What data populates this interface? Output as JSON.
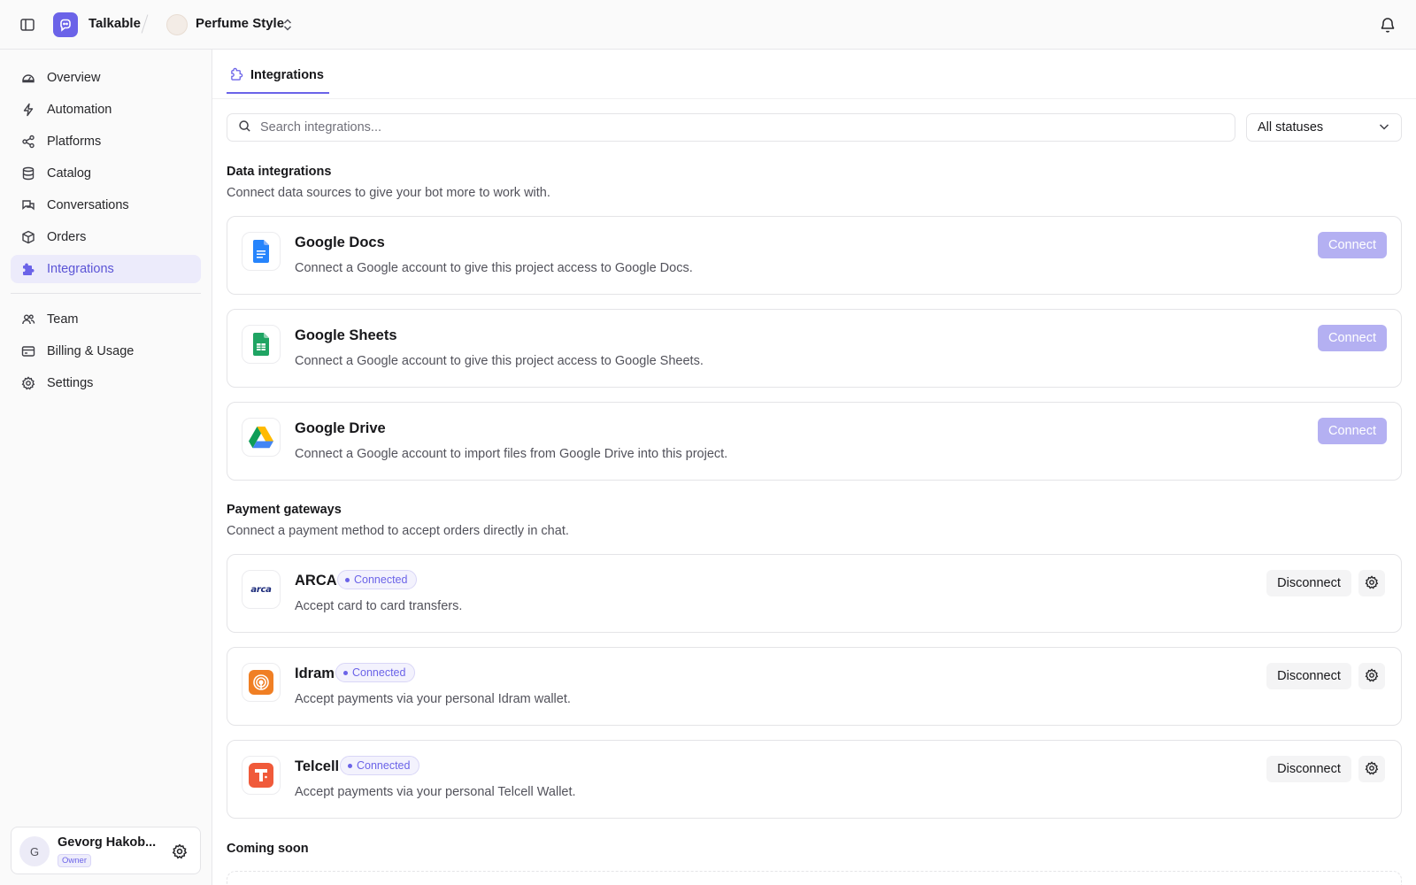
{
  "header": {
    "sidebar_toggle_icon": "sidebar-panel-icon",
    "app_name": "Talkable",
    "project_name": "Perfume Style",
    "notifications_icon": "bell-icon"
  },
  "sidebar": {
    "items": [
      {
        "label": "Overview",
        "icon": "dashboard-gauge-icon"
      },
      {
        "label": "Automation",
        "icon": "bolt-icon"
      },
      {
        "label": "Platforms",
        "icon": "share-nodes-icon"
      },
      {
        "label": "Catalog",
        "icon": "database-icon"
      },
      {
        "label": "Conversations",
        "icon": "chat-bubbles-icon"
      },
      {
        "label": "Orders",
        "icon": "box-icon"
      },
      {
        "label": "Integrations",
        "icon": "puzzle-icon",
        "active": true
      },
      {
        "label": "Team",
        "icon": "users-icon"
      },
      {
        "label": "Billing & Usage",
        "icon": "credit-card-icon"
      },
      {
        "label": "Settings",
        "icon": "gear-icon"
      }
    ],
    "user": {
      "initial": "G",
      "name": "Gevorg Hakob...",
      "role": "Owner"
    }
  },
  "tabs": [
    {
      "label": "Integrations",
      "icon": "puzzle-icon",
      "active": true
    }
  ],
  "search": {
    "placeholder": "Search integrations..."
  },
  "status_filter": {
    "selected": "All statuses"
  },
  "data_integrations": {
    "title": "Data integrations",
    "description": "Connect data sources to give your bot more to work with.",
    "items": [
      {
        "name": "Google Docs",
        "description": "Connect a Google account to give this project access to Google Docs.",
        "action": "Connect"
      },
      {
        "name": "Google Sheets",
        "description": "Connect a Google account to give this project access to Google Sheets.",
        "action": "Connect"
      },
      {
        "name": "Google Drive",
        "description": "Connect a Google account to import files from Google Drive into this project.",
        "action": "Connect"
      }
    ]
  },
  "payment_gateways": {
    "title": "Payment gateways",
    "description": "Connect a payment method to accept orders directly in chat.",
    "items": [
      {
        "name": "ARCA",
        "logo_text": "arca",
        "status": "Connected",
        "description": "Accept card to card transfers.",
        "action": "Disconnect"
      },
      {
        "name": "Idram",
        "status": "Connected",
        "description": "Accept payments via your personal Idram wallet.",
        "action": "Disconnect"
      },
      {
        "name": "Telcell",
        "status": "Connected",
        "description": "Accept payments via your personal Telcell Wallet.",
        "action": "Disconnect"
      }
    ]
  },
  "coming_soon": {
    "title": "Coming soon"
  },
  "colors": {
    "accent": "#6b63e8",
    "connect_disabled": "#b4b0f2",
    "active_nav_bg": "#ecebfb"
  }
}
